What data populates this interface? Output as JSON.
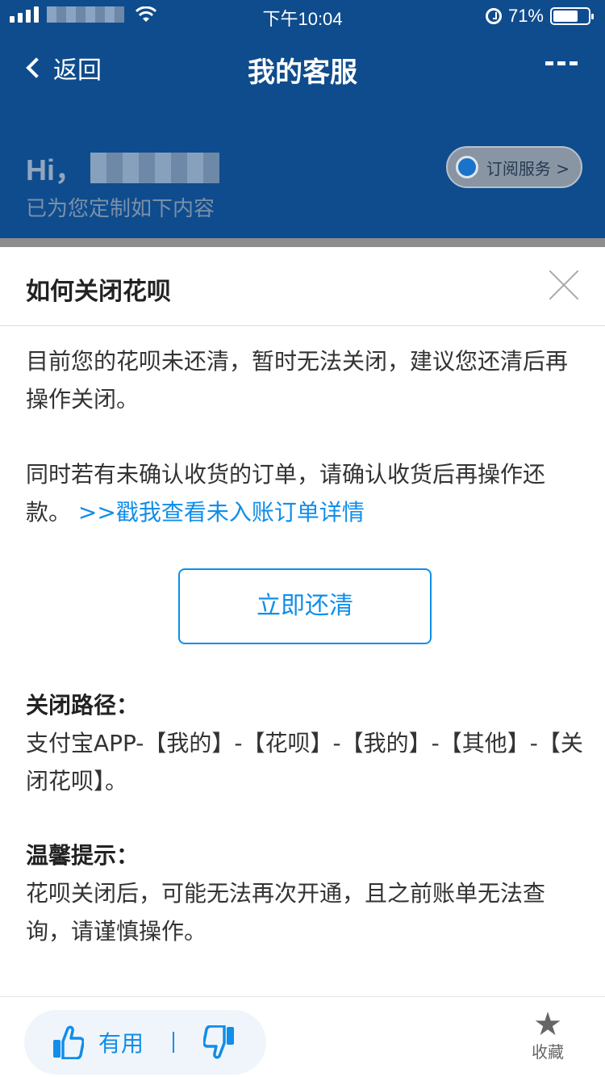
{
  "status_bar": {
    "time": "下午10:04",
    "battery": "71%",
    "battery_level": 0.71
  },
  "nav": {
    "back_label": "返回",
    "title": "我的客服"
  },
  "header": {
    "greeting": "Hi，",
    "subtitle": "已为您定制如下内容",
    "subscribe_label": "订阅服务 >"
  },
  "sheet": {
    "title": "如何关闭花呗",
    "para1": "目前您的花呗未还清，暂时无法关闭，建议您还清后再操作关闭。",
    "para2_text": "同时若有未确认收货的订单，请确认收货后再操作还款。",
    "para2_link": ">>戳我查看未入账订单详情",
    "pay_button": "立即还清",
    "path_title": "关闭路径：",
    "path_text": "支付宝APP-【我的】-【花呗】-【我的】-【其他】-【关闭花呗】。",
    "tips_title": "温馨提示：",
    "tips_text": "花呗关闭后，可能无法再次开通，且之前账单无法查询，请谨慎操作。"
  },
  "footer": {
    "useful_label": "有用",
    "divider": "|",
    "collect_label": "收藏"
  },
  "icons": [
    "signal-icon",
    "wifi-icon",
    "alarm-icon",
    "battery-icon",
    "back-icon",
    "more-icon",
    "subscribe-icon",
    "close-icon",
    "thumbs-up-icon",
    "thumbs-down-icon",
    "star-icon"
  ],
  "colors": {
    "nav_blue": "#0f4c8d",
    "link_blue": "#108ee9",
    "sheet_bg": "#ffffff"
  }
}
